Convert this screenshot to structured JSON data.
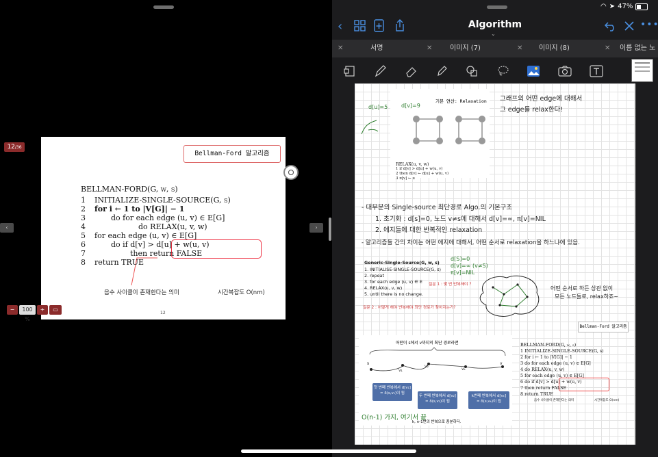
{
  "status": {
    "battery": "47%"
  },
  "left": {
    "page_badge": "12",
    "page_total": "/36",
    "prev_arrow": "‹",
    "next_arrow": "›",
    "zoom_minus": "−",
    "zoom_value": "100 %",
    "zoom_plus": "+",
    "slide": {
      "title_box": "Bellman-Ford 알고리즘",
      "algo_lines": [
        {
          "no": "",
          "text": "BELLMAN-FORD(G, w, s)"
        },
        {
          "no": "1",
          "text": "INITIALIZE-SINGLE-SOURCE(G, s)"
        },
        {
          "no": "2",
          "text": "for i ← 1 to |V[G]| − 1"
        },
        {
          "no": "3",
          "text": "do for each edge (u, v) ∈ E[G]"
        },
        {
          "no": "4",
          "text": "do RELAX(u, v, w)"
        },
        {
          "no": "5",
          "text": "for each edge (u, v) ∈ E[G]"
        },
        {
          "no": "6",
          "text": "do if d[v] > d[u] + w(u, v)"
        },
        {
          "no": "7",
          "text": "then return FALSE"
        },
        {
          "no": "8",
          "text": "return TRUE"
        }
      ],
      "note_negative": "음수 사이클이 존재한다는 의미",
      "note_complexity": "시간복잡도 O(nm)",
      "page_number": "12"
    }
  },
  "right": {
    "title": "Algorithm",
    "tabs": [
      {
        "label": "서명"
      },
      {
        "label": "이미지 (7)"
      },
      {
        "label": "이미지 (8)"
      },
      {
        "label": "이름 없는 노트"
      }
    ],
    "tools": [
      "lasso-select-icon",
      "pen-icon",
      "eraser-icon",
      "highlighter-icon",
      "shapes-icon",
      "lasso-icon",
      "image-icon",
      "camera-icon",
      "text-icon"
    ],
    "note": {
      "basic_op": "기본 연산: Relaxation",
      "hw_top_right_1": "그래프의 어떤 edge에 대해서",
      "hw_top_right_2": "그 edge를 relax한다!",
      "hw_d": "d[u]=5",
      "hw_dv": "d[v]=9",
      "relax_code_title": "RELAX(u, v, w)",
      "relax_code_1": "1  if d[v] > d[u] + w(u, v)",
      "relax_code_2": "2     then d[v] ← d[u] + w(u, v)",
      "relax_code_3": "3          π[v] ← u",
      "hw_line1": "- 대부분의 Single-source 최단경로 Algo.의 기본구조",
      "hw_line2": "1. 초기화 : d[s]=0,  노드 v≠s에 대해서  d[v]=∞, π[v]=NIL",
      "hw_line3": "2. 에지들에 대한 반복적인 relaxation",
      "hw_line4": "- 알고리즘들 간의 차이는 어떤 에지에 대해서, 어떤 순서로 relaxation을 하느냐에 있음.",
      "generic_title": "Generic-Single-Source(G, w, s)",
      "generic_1": "1.  INITIALISE-SINGLE-SOURCE(G, s)",
      "generic_2": "2.  repeat",
      "generic_3": "3.      for each edge (u, v) ∈ E",
      "generic_4": "4.          RELAX(u, v, w)",
      "generic_5": "5.  until there is no change.",
      "q1": "질문 1 : 몇 번 반복해야 ?",
      "q2": "질문 2 : 어떻게 해야 반복해야 최단 경로가 찾아지는가?",
      "hw_init1": "d[S]=0",
      "hw_init2": "d[v]=∞ (v≠S)",
      "hw_init3": "π[v]=NIL",
      "hw_cloud_1": "어떤 순서로 하든 상관 없이",
      "hw_cloud_2": "모든 노드들로, relax하죠~",
      "bf_box": "Bellman-Ford 알고리즘",
      "path_title": "어떤이 s에서 v까지의 최단 경로라면",
      "path_nodes": [
        "s",
        "v₁",
        "v₂",
        "v₃",
        "vₖ",
        "v"
      ],
      "blue_1": "첫 번째 반복에서 d[v₁] = δ(s,v₁)이 됨",
      "blue_2": "두 번째 반복에서 d[v₂] = δ(s,v₂)이 됨",
      "blue_3": "k번째 반복에서 d[vₖ] = δ(s,vₖ)이 됨",
      "hw_bottom": "O(n-1) 가지, 여기서 끝",
      "bottom_caption": "k, n-1번의 반복으로 충분하다.",
      "mini_algo": [
        "BELLMAN-FORD(G, w, s)",
        "1  INITIALIZE-SINGLE-SOURCE(G, s)",
        "2  for i ← 1 to |V[G]| − 1",
        "3       do for each edge (u, v) ∈ E[G]",
        "4            do RELAX(u, v, w)",
        "5  for each edge (u, v) ∈ E[G]",
        "6       do if d[v] > d[u] + w(u, v)",
        "7            then return FALSE",
        "8  return TRUE"
      ],
      "mini_note_negative": "음수 사이클이 존재한다는 의미",
      "mini_note_complexity": "시간복잡도 O(nm)"
    }
  }
}
